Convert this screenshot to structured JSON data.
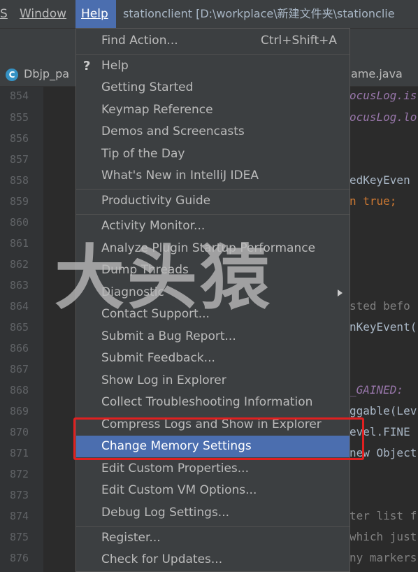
{
  "menubar": {
    "items": [
      {
        "label": "S",
        "underline": "S"
      },
      {
        "label": "Window",
        "underline": "W"
      },
      {
        "label": "Help",
        "underline": "H",
        "active": true
      }
    ],
    "title": "stationclient [D:\\workplace\\新建文件夹\\stationclie"
  },
  "tabs": [
    {
      "label": "Dbjp_pa",
      "icon": "class-c-icon",
      "icon_glyph": "C"
    },
    {
      "label": "ame.java"
    }
  ],
  "editor": {
    "line_numbers": [
      "854",
      "855",
      "856",
      "857",
      "858",
      "859",
      "860",
      "861",
      "862",
      "863",
      "864",
      "865",
      "866",
      "867",
      "868",
      "869",
      "870",
      "871",
      "872",
      "873",
      "874",
      "875",
      "876"
    ],
    "code_fragments": [
      {
        "text": "ocusLog.is",
        "italic": true,
        "color": "#9876aa"
      },
      {
        "text": "ocusLog.lo",
        "italic": true,
        "color": "#9876aa"
      },
      {
        "text": "edKeyEven",
        "italic": false,
        "color": "#a9b7c6"
      },
      {
        "text": "n true;",
        "italic": false,
        "color": "#cc7832"
      },
      {
        "text": "sted befo",
        "italic": false,
        "color": "#808080"
      },
      {
        "text": "nKeyEvent(",
        "italic": false,
        "color": "#a9b7c6"
      },
      {
        "text": "_GAINED:",
        "italic": true,
        "color": "#9876aa"
      },
      {
        "text": "ggable(Lev",
        "italic": false,
        "color": "#a9b7c6"
      },
      {
        "text": "evel.FINE",
        "italic": false,
        "color": "#a9b7c6"
      },
      {
        "text": "new Object",
        "italic": false,
        "color": "#a9b7c6"
      },
      {
        "text": "ter list f",
        "italic": false,
        "color": "#808080"
      },
      {
        "text": "which just",
        "italic": false,
        "color": "#808080"
      },
      {
        "text": "ny markers",
        "italic": false,
        "color": "#808080"
      }
    ]
  },
  "help_menu": {
    "find_action": {
      "label": "Find Action...",
      "shortcut": "Ctrl+Shift+A"
    },
    "help_icon": "?",
    "items": [
      {
        "label": "Help"
      },
      {
        "label": "Getting Started"
      },
      {
        "label": "Keymap Reference"
      },
      {
        "label": "Demos and Screencasts"
      },
      {
        "label": "Tip of the Day"
      },
      {
        "label": "What's New in IntelliJ IDEA"
      },
      {
        "label": "Productivity Guide"
      },
      {
        "label": "Activity Monitor..."
      },
      {
        "label": "Analyze Plugin Startup Performance"
      },
      {
        "label": "Dump Threads"
      },
      {
        "label": "Diagnostic",
        "submenu": true
      },
      {
        "label": "Contact Support..."
      },
      {
        "label": "Submit a Bug Report..."
      },
      {
        "label": "Submit Feedback..."
      },
      {
        "label": "Show Log in Explorer"
      },
      {
        "label": "Collect Troubleshooting Information"
      },
      {
        "label": "Compress Logs and Show in Explorer"
      },
      {
        "label": "Change Memory Settings",
        "selected": true
      },
      {
        "label": "Edit Custom Properties..."
      },
      {
        "label": "Edit Custom VM Options..."
      },
      {
        "label": "Debug Log Settings..."
      },
      {
        "label": "Register..."
      },
      {
        "label": "Check for Updates..."
      }
    ]
  },
  "watermark": "大头猿",
  "colors": {
    "menu_bg": "#3c3f41",
    "editor_bg": "#2b2b2b",
    "selection": "#4b6eaf",
    "highlight_box": "#e02020"
  }
}
